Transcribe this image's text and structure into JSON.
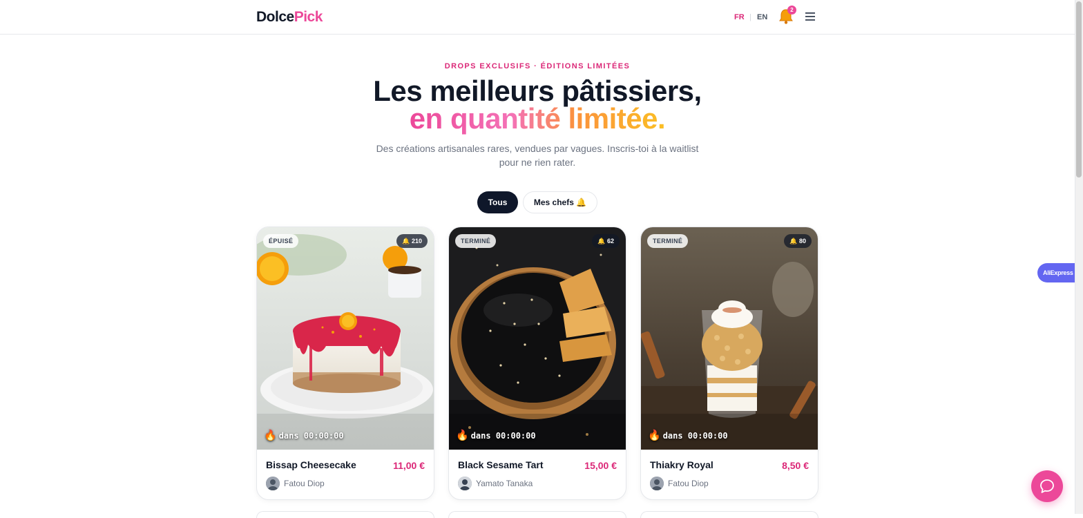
{
  "header": {
    "logo_part1": "Dolce",
    "logo_part2": "Pick",
    "lang_fr": "FR",
    "lang_sep": "|",
    "lang_en": "EN",
    "notification_count": "2",
    "icons": [
      "bell-icon",
      "menu-icon"
    ]
  },
  "hero": {
    "eyebrow": "DROPS EXCLUSIFS · ÉDITIONS LIMITÉES",
    "title_line1": "Les meilleurs pâtissiers,",
    "title_line2": "en quantité limitée.",
    "subtitle": "Des créations artisanales rares, vendues par vagues. Inscris-toi à la waitlist pour ne rien rater."
  },
  "filters": {
    "all": "Tous",
    "my_chefs": "Mes chefs 🔔"
  },
  "cards": [
    {
      "status": "ÉPUISÉ",
      "waitlist": "🔔 210",
      "timer_fire": "🔥",
      "timer": "dans 00:00:00",
      "name": "Bissap Cheesecake",
      "price": "11,00 €",
      "chef": "Fatou Diop"
    },
    {
      "status": "TERMINÉ",
      "waitlist": "🔔 62",
      "timer_fire": "🔥",
      "timer": "dans 00:00:00",
      "name": "Black Sesame Tart",
      "price": "15,00 €",
      "chef": "Yamato Tanaka"
    },
    {
      "status": "TERMINÉ",
      "waitlist": "🔔 80",
      "timer_fire": "🔥",
      "timer": "dans 00:00:00",
      "name": "Thiakry Royal",
      "price": "8,50 €",
      "chef": "Fatou Diop"
    }
  ],
  "floating": {
    "aliexpress": "AliExpress"
  },
  "colors": {
    "accent": "#ec4899",
    "dark": "#0f172a",
    "price": "#db2777"
  }
}
